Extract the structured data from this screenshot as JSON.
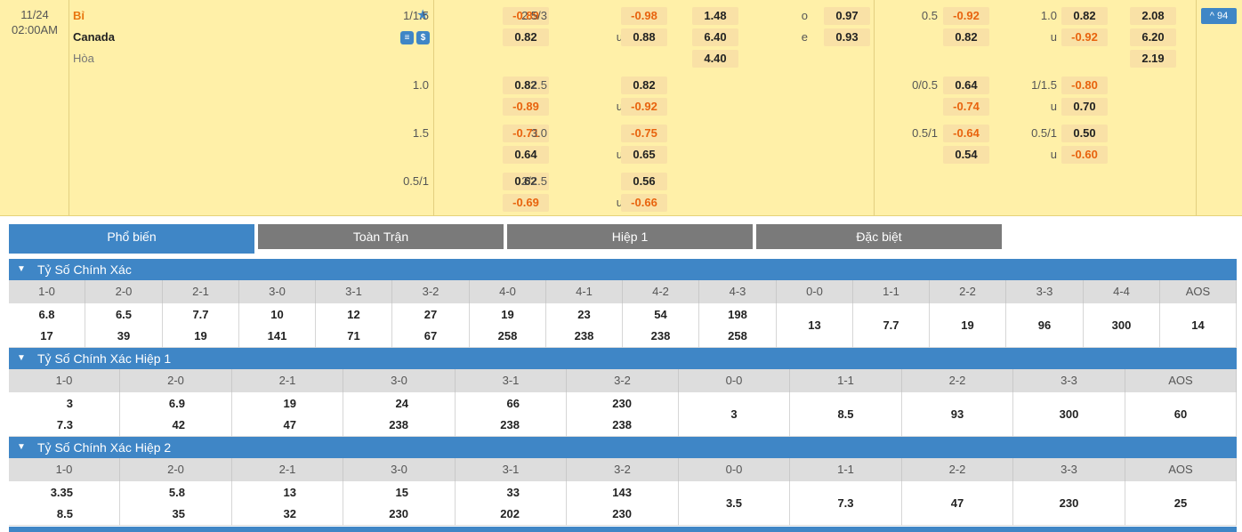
{
  "match": {
    "date": "11/24",
    "time": "02:00AM",
    "home": "Bỉ",
    "away": "Canada",
    "draw": "Hòa",
    "more_count": "^ 94"
  },
  "odds_rows": [
    {
      "l1": "1/1.5",
      "o1": "-0.89",
      "o2": "0.82",
      "l2": "2.5/3",
      "o3": "-0.98",
      "l3": "u",
      "o4": "0.88",
      "x1": "1.48",
      "x2": "6.40",
      "x3": "4.40",
      "l4": "o",
      "o5": "0.97",
      "l5": "e",
      "o6": "0.93",
      "l6": "0.5",
      "o7": "-0.92",
      "o8": "0.82",
      "l7": "1.0",
      "o9": "0.82",
      "l8": "u",
      "o10": "-0.92",
      "y1": "2.08",
      "y2": "6.20",
      "y3": "2.19"
    },
    {
      "l1": "1.0",
      "o1": "0.82",
      "o2": "-0.89",
      "l2": "2.5",
      "o3": "0.82",
      "l3": "u",
      "o4": "-0.92",
      "l6": "0/0.5",
      "o7": "0.64",
      "o8": "-0.74",
      "l7": "1/1.5",
      "o9": "-0.80",
      "l8": "u",
      "o10": "0.70"
    },
    {
      "l1": "1.5",
      "o1": "-0.71",
      "o2": "0.64",
      "l2": "3.0",
      "o3": "-0.75",
      "l3": "u",
      "o4": "0.65",
      "l6": "0.5/1",
      "o7": "-0.64",
      "o8": "0.54",
      "l7": "0.5/1",
      "o9": "0.50",
      "l8": "u",
      "o10": "-0.60"
    },
    {
      "l1": "0.5/1",
      "o1": "0.62",
      "o2": "-0.69",
      "l2": "2/2.5",
      "o3": "0.56",
      "l3": "u",
      "o4": "-0.66"
    }
  ],
  "tabs": [
    "Phổ biến",
    "Toàn Trận",
    "Hiệp 1",
    "Đặc biệt"
  ],
  "sections": [
    {
      "title": "Tỷ Số Chính Xác",
      "cells": [
        {
          "h": "1-0",
          "t": "6.8",
          "b": "17"
        },
        {
          "h": "2-0",
          "t": "6.5",
          "b": "39"
        },
        {
          "h": "2-1",
          "t": "7.7",
          "b": "19"
        },
        {
          "h": "3-0",
          "t": "10",
          "b": "141"
        },
        {
          "h": "3-1",
          "t": "12",
          "b": "71"
        },
        {
          "h": "3-2",
          "t": "27",
          "b": "67"
        },
        {
          "h": "4-0",
          "t": "19",
          "b": "258"
        },
        {
          "h": "4-1",
          "t": "23",
          "b": "238"
        },
        {
          "h": "4-2",
          "t": "54",
          "b": "238"
        },
        {
          "h": "4-3",
          "t": "198",
          "b": "258"
        },
        {
          "h": "0-0",
          "m": "13"
        },
        {
          "h": "1-1",
          "m": "7.7"
        },
        {
          "h": "2-2",
          "m": "19"
        },
        {
          "h": "3-3",
          "m": "96"
        },
        {
          "h": "4-4",
          "m": "300"
        },
        {
          "h": "AOS",
          "m": "14"
        }
      ]
    },
    {
      "title": "Tỷ Số Chính Xác Hiệp 1",
      "cells": [
        {
          "h": "1-0",
          "t": "3",
          "b": "7.3"
        },
        {
          "h": "2-0",
          "t": "6.9",
          "b": "42"
        },
        {
          "h": "2-1",
          "t": "19",
          "b": "47"
        },
        {
          "h": "3-0",
          "t": "24",
          "b": "238"
        },
        {
          "h": "3-1",
          "t": "66",
          "b": "238"
        },
        {
          "h": "3-2",
          "t": "230",
          "b": "238"
        },
        {
          "h": "0-0",
          "m": "3"
        },
        {
          "h": "1-1",
          "m": "8.5"
        },
        {
          "h": "2-2",
          "m": "93"
        },
        {
          "h": "3-3",
          "m": "300"
        },
        {
          "h": "AOS",
          "m": "60"
        }
      ]
    },
    {
      "title": "Tỷ Số Chính Xác Hiệp 2",
      "cells": [
        {
          "h": "1-0",
          "t": "3.35",
          "b": "8.5"
        },
        {
          "h": "2-0",
          "t": "5.8",
          "b": "35"
        },
        {
          "h": "2-1",
          "t": "13",
          "b": "32"
        },
        {
          "h": "3-0",
          "t": "15",
          "b": "230"
        },
        {
          "h": "3-1",
          "t": "33",
          "b": "202"
        },
        {
          "h": "3-2",
          "t": "143",
          "b": "230"
        },
        {
          "h": "0-0",
          "m": "3.5"
        },
        {
          "h": "1-1",
          "m": "7.3"
        },
        {
          "h": "2-2",
          "m": "47"
        },
        {
          "h": "3-3",
          "m": "230"
        },
        {
          "h": "AOS",
          "m": "25"
        }
      ]
    }
  ],
  "colors": {
    "header_bg": "#fff0a8",
    "odd_bg": "#f9e1a6",
    "accent": "#3f86c6",
    "negative": "#e8630e",
    "home": "#e8760e"
  }
}
